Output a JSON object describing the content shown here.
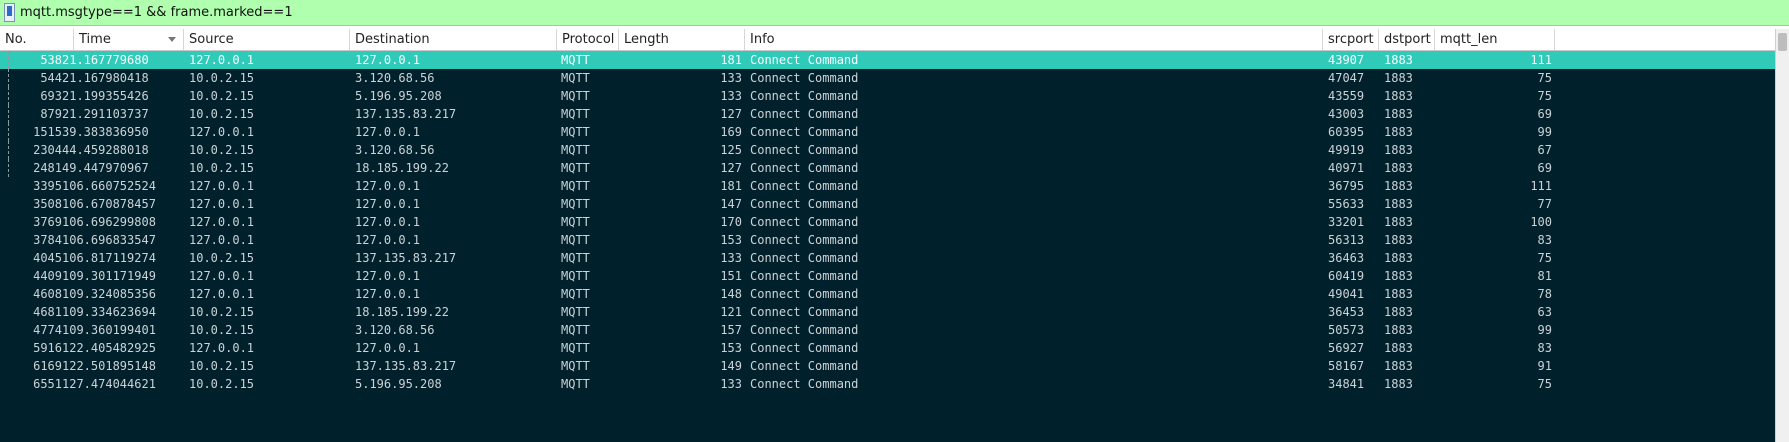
{
  "filter": {
    "value": "mqtt.msgtype==1 && frame.marked==1"
  },
  "columns": [
    {
      "key": "no",
      "label": "No."
    },
    {
      "key": "time",
      "label": "Time"
    },
    {
      "key": "source",
      "label": "Source"
    },
    {
      "key": "destination",
      "label": "Destination"
    },
    {
      "key": "protocol",
      "label": "Protocol"
    },
    {
      "key": "length",
      "label": "Length"
    },
    {
      "key": "info",
      "label": "Info"
    },
    {
      "key": "srcport",
      "label": "srcport"
    },
    {
      "key": "dstport",
      "label": "dstport"
    },
    {
      "key": "mqtt_len",
      "label": "mqtt_len"
    }
  ],
  "sort": {
    "column": "time",
    "direction": "descending-arrow"
  },
  "colors": {
    "filter_bg": "#afffaf",
    "list_bg": "#00202c",
    "selected_bg": "#2fcab8"
  },
  "selected_row": 0,
  "packets": [
    {
      "no": "538",
      "time": "21.167779680",
      "source": "127.0.0.1",
      "destination": "127.0.0.1",
      "protocol": "MQTT",
      "length": "181",
      "info": "Connect Command",
      "srcport": "43907",
      "dstport": "1883",
      "mqtt_len": "111"
    },
    {
      "no": "544",
      "time": "21.167980418",
      "source": "10.0.2.15",
      "destination": "3.120.68.56",
      "protocol": "MQTT",
      "length": "133",
      "info": "Connect Command",
      "srcport": "47047",
      "dstport": "1883",
      "mqtt_len": "75"
    },
    {
      "no": "693",
      "time": "21.199355426",
      "source": "10.0.2.15",
      "destination": "5.196.95.208",
      "protocol": "MQTT",
      "length": "133",
      "info": "Connect Command",
      "srcport": "43559",
      "dstport": "1883",
      "mqtt_len": "75"
    },
    {
      "no": "879",
      "time": "21.291103737",
      "source": "10.0.2.15",
      "destination": "137.135.83.217",
      "protocol": "MQTT",
      "length": "127",
      "info": "Connect Command",
      "srcport": "43003",
      "dstport": "1883",
      "mqtt_len": "69"
    },
    {
      "no": "1515",
      "time": "39.383836950",
      "source": "127.0.0.1",
      "destination": "127.0.0.1",
      "protocol": "MQTT",
      "length": "169",
      "info": "Connect Command",
      "srcport": "60395",
      "dstport": "1883",
      "mqtt_len": "99"
    },
    {
      "no": "2304",
      "time": "44.459288018",
      "source": "10.0.2.15",
      "destination": "3.120.68.56",
      "protocol": "MQTT",
      "length": "125",
      "info": "Connect Command",
      "srcport": "49919",
      "dstport": "1883",
      "mqtt_len": "67"
    },
    {
      "no": "2481",
      "time": "49.447970967",
      "source": "10.0.2.15",
      "destination": "18.185.199.22",
      "protocol": "MQTT",
      "length": "127",
      "info": "Connect Command",
      "srcport": "40971",
      "dstport": "1883",
      "mqtt_len": "69"
    },
    {
      "no": "3395",
      "time": "106.660752524",
      "source": "127.0.0.1",
      "destination": "127.0.0.1",
      "protocol": "MQTT",
      "length": "181",
      "info": "Connect Command",
      "srcport": "36795",
      "dstport": "1883",
      "mqtt_len": "111"
    },
    {
      "no": "3508",
      "time": "106.670878457",
      "source": "127.0.0.1",
      "destination": "127.0.0.1",
      "protocol": "MQTT",
      "length": "147",
      "info": "Connect Command",
      "srcport": "55633",
      "dstport": "1883",
      "mqtt_len": "77"
    },
    {
      "no": "3769",
      "time": "106.696299808",
      "source": "127.0.0.1",
      "destination": "127.0.0.1",
      "protocol": "MQTT",
      "length": "170",
      "info": "Connect Command",
      "srcport": "33201",
      "dstport": "1883",
      "mqtt_len": "100"
    },
    {
      "no": "3784",
      "time": "106.696833547",
      "source": "127.0.0.1",
      "destination": "127.0.0.1",
      "protocol": "MQTT",
      "length": "153",
      "info": "Connect Command",
      "srcport": "56313",
      "dstport": "1883",
      "mqtt_len": "83"
    },
    {
      "no": "4045",
      "time": "106.817119274",
      "source": "10.0.2.15",
      "destination": "137.135.83.217",
      "protocol": "MQTT",
      "length": "133",
      "info": "Connect Command",
      "srcport": "36463",
      "dstport": "1883",
      "mqtt_len": "75"
    },
    {
      "no": "4409",
      "time": "109.301171949",
      "source": "127.0.0.1",
      "destination": "127.0.0.1",
      "protocol": "MQTT",
      "length": "151",
      "info": "Connect Command",
      "srcport": "60419",
      "dstport": "1883",
      "mqtt_len": "81"
    },
    {
      "no": "4608",
      "time": "109.324085356",
      "source": "127.0.0.1",
      "destination": "127.0.0.1",
      "protocol": "MQTT",
      "length": "148",
      "info": "Connect Command",
      "srcport": "49041",
      "dstport": "1883",
      "mqtt_len": "78"
    },
    {
      "no": "4681",
      "time": "109.334623694",
      "source": "10.0.2.15",
      "destination": "18.185.199.22",
      "protocol": "MQTT",
      "length": "121",
      "info": "Connect Command",
      "srcport": "36453",
      "dstport": "1883",
      "mqtt_len": "63"
    },
    {
      "no": "4774",
      "time": "109.360199401",
      "source": "10.0.2.15",
      "destination": "3.120.68.56",
      "protocol": "MQTT",
      "length": "157",
      "info": "Connect Command",
      "srcport": "50573",
      "dstport": "1883",
      "mqtt_len": "99"
    },
    {
      "no": "5916",
      "time": "122.405482925",
      "source": "127.0.0.1",
      "destination": "127.0.0.1",
      "protocol": "MQTT",
      "length": "153",
      "info": "Connect Command",
      "srcport": "56927",
      "dstport": "1883",
      "mqtt_len": "83"
    },
    {
      "no": "6169",
      "time": "122.501895148",
      "source": "10.0.2.15",
      "destination": "137.135.83.217",
      "protocol": "MQTT",
      "length": "149",
      "info": "Connect Command",
      "srcport": "58167",
      "dstport": "1883",
      "mqtt_len": "91"
    },
    {
      "no": "6551",
      "time": "127.474044621",
      "source": "10.0.2.15",
      "destination": "5.196.95.208",
      "protocol": "MQTT",
      "length": "133",
      "info": "Connect Command",
      "srcport": "34841",
      "dstport": "1883",
      "mqtt_len": "75"
    }
  ]
}
